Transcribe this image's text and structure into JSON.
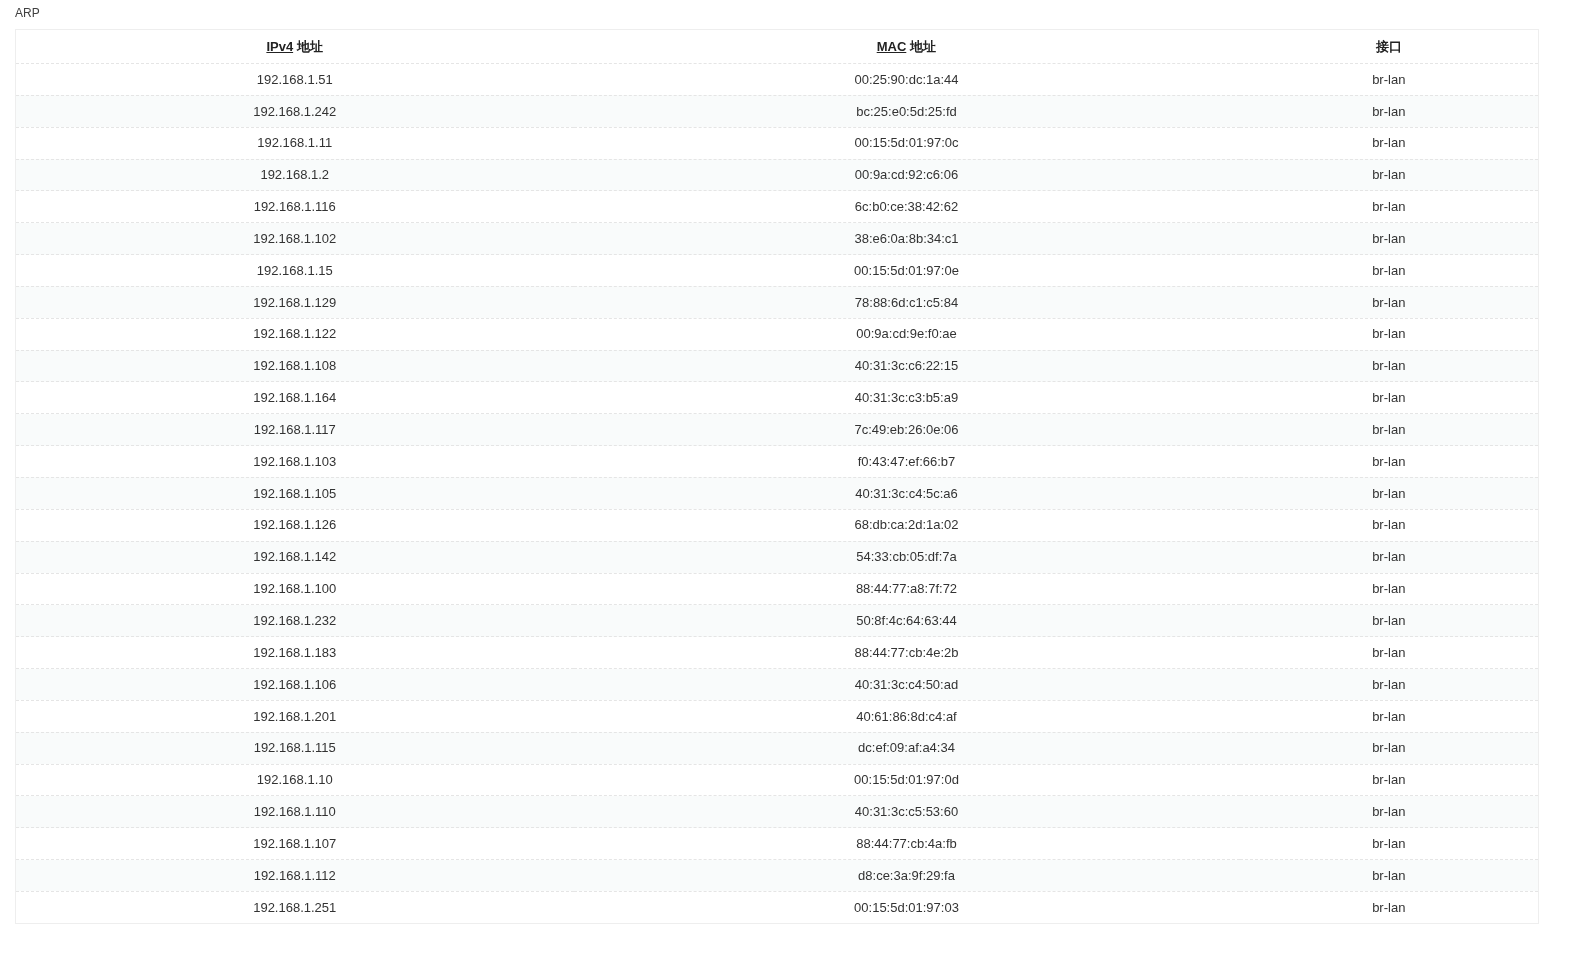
{
  "section_title": "ARP",
  "table": {
    "columns": [
      {
        "abbr": "IPv4",
        "label": "地址"
      },
      {
        "abbr": "MAC",
        "label": "地址"
      },
      {
        "label": "接口"
      }
    ],
    "rows": [
      [
        "192.168.1.51",
        "00:25:90:dc:1a:44",
        "br-lan"
      ],
      [
        "192.168.1.242",
        "bc:25:e0:5d:25:fd",
        "br-lan"
      ],
      [
        "192.168.1.11",
        "00:15:5d:01:97:0c",
        "br-lan"
      ],
      [
        "192.168.1.2",
        "00:9a:cd:92:c6:06",
        "br-lan"
      ],
      [
        "192.168.1.116",
        "6c:b0:ce:38:42:62",
        "br-lan"
      ],
      [
        "192.168.1.102",
        "38:e6:0a:8b:34:c1",
        "br-lan"
      ],
      [
        "192.168.1.15",
        "00:15:5d:01:97:0e",
        "br-lan"
      ],
      [
        "192.168.1.129",
        "78:88:6d:c1:c5:84",
        "br-lan"
      ],
      [
        "192.168.1.122",
        "00:9a:cd:9e:f0:ae",
        "br-lan"
      ],
      [
        "192.168.1.108",
        "40:31:3c:c6:22:15",
        "br-lan"
      ],
      [
        "192.168.1.164",
        "40:31:3c:c3:b5:a9",
        "br-lan"
      ],
      [
        "192.168.1.117",
        "7c:49:eb:26:0e:06",
        "br-lan"
      ],
      [
        "192.168.1.103",
        "f0:43:47:ef:66:b7",
        "br-lan"
      ],
      [
        "192.168.1.105",
        "40:31:3c:c4:5c:a6",
        "br-lan"
      ],
      [
        "192.168.1.126",
        "68:db:ca:2d:1a:02",
        "br-lan"
      ],
      [
        "192.168.1.142",
        "54:33:cb:05:df:7a",
        "br-lan"
      ],
      [
        "192.168.1.100",
        "88:44:77:a8:7f:72",
        "br-lan"
      ],
      [
        "192.168.1.232",
        "50:8f:4c:64:63:44",
        "br-lan"
      ],
      [
        "192.168.1.183",
        "88:44:77:cb:4e:2b",
        "br-lan"
      ],
      [
        "192.168.1.106",
        "40:31:3c:c4:50:ad",
        "br-lan"
      ],
      [
        "192.168.1.201",
        "40:61:86:8d:c4:af",
        "br-lan"
      ],
      [
        "192.168.1.115",
        "dc:ef:09:af:a4:34",
        "br-lan"
      ],
      [
        "192.168.1.10",
        "00:15:5d:01:97:0d",
        "br-lan"
      ],
      [
        "192.168.1.110",
        "40:31:3c:c5:53:60",
        "br-lan"
      ],
      [
        "192.168.1.107",
        "88:44:77:cb:4a:fb",
        "br-lan"
      ],
      [
        "192.168.1.112",
        "d8:ce:3a:9f:29:fa",
        "br-lan"
      ],
      [
        "192.168.1.251",
        "00:15:5d:01:97:03",
        "br-lan"
      ]
    ]
  }
}
